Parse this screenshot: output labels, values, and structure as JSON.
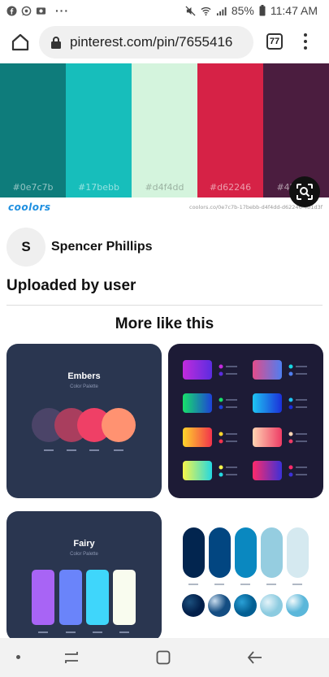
{
  "status_bar": {
    "battery": "85%",
    "time": "11:47 AM",
    "overflow": "···"
  },
  "browser": {
    "url": "pinterest.com/pin/7655416",
    "tab_count": "77"
  },
  "pin": {
    "palette": [
      {
        "hex": "#0e7c7b",
        "color": "#0e7c7b"
      },
      {
        "hex": "#17bebb",
        "color": "#17bebb"
      },
      {
        "hex": "#d4f4dd",
        "color": "#d4f4dd"
      },
      {
        "hex": "#d62246",
        "color": "#d62246"
      },
      {
        "hex": "#4b1d3f",
        "color": "#4b1d3f"
      }
    ],
    "brand": "coolors",
    "source_url": "coolors.co/0e7c7b-17bebb-d4f4dd-d62246-4b1d3f"
  },
  "user": {
    "initial": "S",
    "name": "Spencer Phillips"
  },
  "uploaded_label": "Uploaded by user",
  "more_title": "More like this",
  "cards": {
    "embers": {
      "title": "Embers",
      "subtitle": "Color Palette"
    },
    "fairy": {
      "title": "Fairy",
      "subtitle": "Color Palette"
    }
  }
}
